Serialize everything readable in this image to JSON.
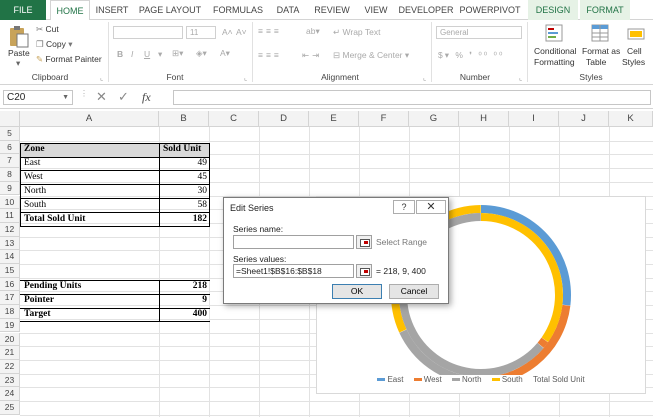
{
  "ribbon_tabs": [
    "FILE",
    "HOME",
    "INSERT",
    "PAGE LAYOUT",
    "FORMULAS",
    "DATA",
    "REVIEW",
    "VIEW",
    "DEVELOPER",
    "POWERPIVOT",
    "DESIGN",
    "FORMAT"
  ],
  "clipboard": {
    "paste": "Paste",
    "cut": "Cut",
    "copy": "Copy",
    "format_painter": "Format Painter",
    "group": "Clipboard"
  },
  "font": {
    "size": "11",
    "group": "Font"
  },
  "alignment": {
    "wrap_text": "Wrap Text",
    "merge_center": "Merge & Center",
    "group": "Alignment"
  },
  "number": {
    "format": "General",
    "group": "Number"
  },
  "styles": {
    "conditional": "Conditional",
    "conditional2": "Formatting",
    "format_as": "Format as",
    "table": "Table",
    "cell": "Cell",
    "cell_styles": "Styles",
    "group": "Styles"
  },
  "formula_bar": {
    "name_box": "C20",
    "fx": "fx"
  },
  "columns": [
    "A",
    "B",
    "C",
    "D",
    "E",
    "F",
    "G",
    "H",
    "I",
    "J",
    "K"
  ],
  "rows": [
    "5",
    "6",
    "7",
    "8",
    "9",
    "10",
    "11",
    "12",
    "13",
    "14",
    "15",
    "16",
    "17",
    "18",
    "19",
    "20",
    "21",
    "22",
    "23",
    "24",
    "25"
  ],
  "table": {
    "header": [
      "Zone",
      "Sold Unit"
    ],
    "rows": [
      [
        "East",
        "49"
      ],
      [
        "West",
        "45"
      ],
      [
        "North",
        "30"
      ],
      [
        "South",
        "58"
      ]
    ],
    "total": [
      "Total Sold Unit",
      "182"
    ]
  },
  "summary": [
    [
      "Pending Units",
      "218"
    ],
    [
      "Pointer",
      "9"
    ],
    [
      "Target",
      "400"
    ]
  ],
  "dialog": {
    "title": "Edit Series",
    "help": "?",
    "close": "✕",
    "series_name_label": "Series name:",
    "series_name_value": "",
    "select_range": "Select Range",
    "series_values_label": "Series values:",
    "series_values": "=Sheet1!$B$16:$B$18",
    "values_preview": "= 218, 9, 400",
    "ok": "OK",
    "cancel": "Cancel"
  },
  "chart_data": {
    "type": "doughnut",
    "series": [
      {
        "name": "Total Sold Unit",
        "values": [
          49,
          45,
          30,
          58
        ]
      },
      {
        "name": "",
        "values": [
          218,
          9,
          400
        ]
      }
    ],
    "categories": [
      "East",
      "West",
      "North",
      "South"
    ],
    "legend": [
      "East",
      "West",
      "North",
      "South",
      "Total Sold Unit"
    ],
    "colors": [
      "#5b9bd5",
      "#ed7d31",
      "#a5a5a5",
      "#ffc000"
    ],
    "legend_position": "bottom"
  }
}
